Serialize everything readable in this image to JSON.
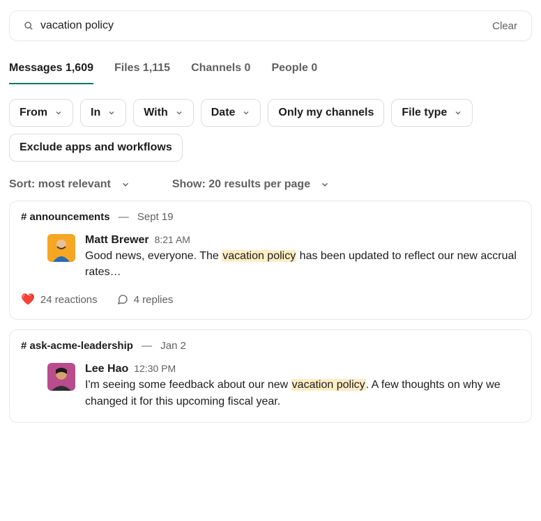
{
  "search": {
    "query": "vacation policy",
    "clear_label": "Clear"
  },
  "tabs": [
    {
      "label": "Messages",
      "count": "1,609",
      "active": true
    },
    {
      "label": "Files",
      "count": "1,115",
      "active": false
    },
    {
      "label": "Channels",
      "count": "0",
      "active": false
    },
    {
      "label": "People",
      "count": "0",
      "active": false
    }
  ],
  "filters": [
    {
      "label": "From",
      "chevron": true
    },
    {
      "label": "In",
      "chevron": true
    },
    {
      "label": "With",
      "chevron": true
    },
    {
      "label": "Date",
      "chevron": true
    },
    {
      "label": "Only my channels",
      "chevron": false
    },
    {
      "label": "File type",
      "chevron": true
    },
    {
      "label": "Exclude apps and workflows",
      "chevron": false
    }
  ],
  "sort": {
    "label": "Sort: most relevant"
  },
  "show": {
    "label": "Show: 20 results per page"
  },
  "results": [
    {
      "channel": "announcements",
      "date": "Sept 19",
      "author": "Matt Brewer",
      "time": "8:21 AM",
      "text_before": "Good news, everyone. The ",
      "highlight": "vacation policy",
      "text_after": " has been updated to reflect our new accrual rates…",
      "avatar_bg": "linear-gradient(135deg,#f5a623 0%,#f5a623 100%)",
      "reactions": {
        "emoji": "❤️",
        "count_label": "24 reactions"
      },
      "replies": {
        "count_label": "4 replies"
      }
    },
    {
      "channel": "ask-acme-leadership",
      "date": "Jan 2",
      "author": "Lee Hao",
      "time": "12:30 PM",
      "text_before": "I'm seeing some feedback about our new ",
      "highlight": "vacation policy",
      "text_after": ". A few thoughts on why we changed it for this upcoming fiscal year.",
      "avatar_bg": "linear-gradient(135deg,#d35c9e 0%,#8b3a6b 100%)",
      "reactions": null,
      "replies": null
    }
  ]
}
